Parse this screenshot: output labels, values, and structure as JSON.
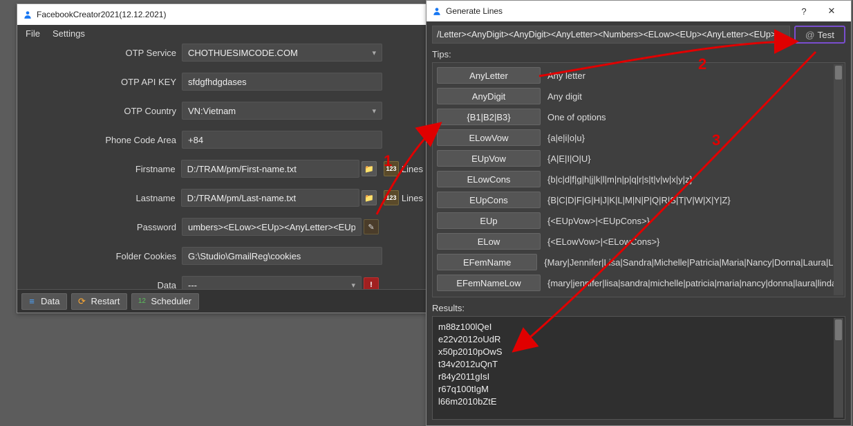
{
  "win1": {
    "title": "FacebookCreator2021(12.12.2021)",
    "menu": {
      "file": "File",
      "settings": "Settings"
    },
    "form": {
      "otp_service": {
        "label": "OTP Service",
        "value": "CHOTHUESIMCODE.COM"
      },
      "otp_api_key": {
        "label": "OTP API KEY",
        "value": "sfdgfhdgdases"
      },
      "otp_country": {
        "label": "OTP Country",
        "value": "VN:Vietnam"
      },
      "phone_code_area": {
        "label": "Phone Code Area",
        "value": "+84"
      },
      "firstname": {
        "label": "Firstname",
        "value": "D:/TRAM/pm/First-name.txt",
        "lines": "Lines"
      },
      "lastname": {
        "label": "Lastname",
        "value": "D:/TRAM/pm/Last-name.txt",
        "lines": "Lines"
      },
      "password": {
        "label": "Password",
        "value": "umbers><ELow><EUp><AnyLetter><EUp>"
      },
      "folder_cookies": {
        "label": "Folder Cookies",
        "value": "G:\\Studio\\GmailReg\\cookies"
      },
      "data": {
        "label": "Data",
        "value": "---"
      }
    },
    "buttons": {
      "data": "Data",
      "restart": "Restart",
      "scheduler": "Scheduler"
    }
  },
  "win2": {
    "title": "Generate Lines",
    "formula": "/Letter><AnyDigit><AnyDigit><AnyLetter><Numbers><ELow><EUp><AnyLetter><EUp>",
    "test_label": "Test",
    "tips_label": "Tips:",
    "tips": [
      {
        "btn": "AnyLetter",
        "desc": "Any letter"
      },
      {
        "btn": "AnyDigit",
        "desc": "Any digit"
      },
      {
        "btn": "{B1|B2|B3}",
        "desc": "One of options"
      },
      {
        "btn": "ELowVow",
        "desc": "{a|e|i|o|u}"
      },
      {
        "btn": "EUpVow",
        "desc": "{A|E|I|O|U}"
      },
      {
        "btn": "ELowCons",
        "desc": "{b|c|d|f|g|h|j|k|l|m|n|p|q|r|s|t|v|w|x|y|z}"
      },
      {
        "btn": "EUpCons",
        "desc": "{B|C|D|F|G|H|J|K|L|M|N|P|Q|R|S|T|V|W|X|Y|Z}"
      },
      {
        "btn": "EUp",
        "desc": "{<EUpVow>|<EUpCons>}"
      },
      {
        "btn": "ELow",
        "desc": "{<ELowVow>|<ELowCons>}"
      },
      {
        "btn": "EFemName",
        "desc": "{Mary|Jennifer|Lisa|Sandra|Michelle|Patricia|Maria|Nancy|Donna|Laura|Linda"
      },
      {
        "btn": "EFemNameLow",
        "desc": "{mary|jennifer|lisa|sandra|michelle|patricia|maria|nancy|donna|laura|linda"
      }
    ],
    "results_label": "Results:",
    "results": [
      "m88z100lQeI",
      "e22v2012oUdR",
      "x50p2010pOwS",
      "t34v2012uQnT",
      "r84y2011gIsI",
      "r67q100tIgM",
      "l66m2010bZtE"
    ]
  },
  "annotations": {
    "n1": "1",
    "n2": "2",
    "n3": "3"
  }
}
